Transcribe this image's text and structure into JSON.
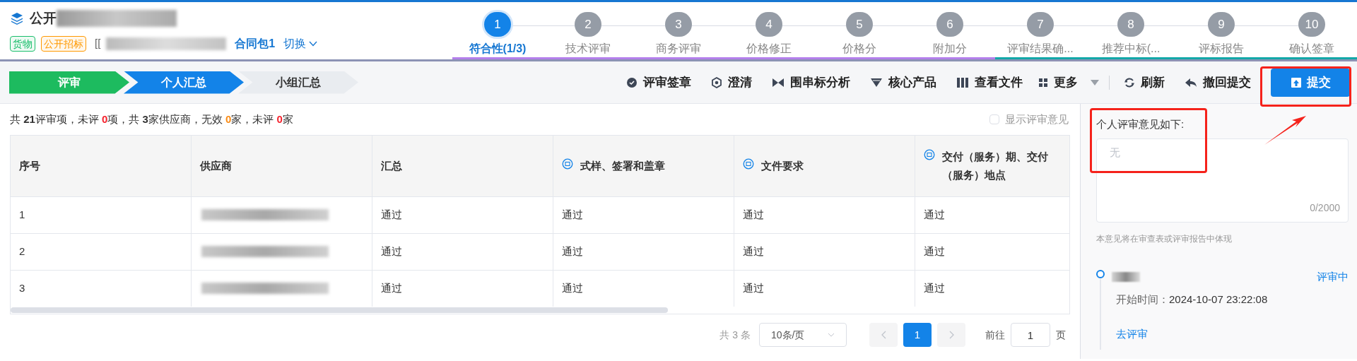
{
  "header": {
    "title": "公开",
    "tags": [
      {
        "label": "货物",
        "color": "#19be6b"
      },
      {
        "label": "公开招标",
        "color": "#ff9900"
      }
    ],
    "project_code": "[[",
    "package": "合同包1",
    "switch": "切换"
  },
  "steps": [
    {
      "number": "1",
      "label": "符合性(1/3)",
      "selected": true,
      "color": "#b37feb"
    },
    {
      "number": "2",
      "label": "技术评审",
      "selected": false,
      "color": "#b37feb"
    },
    {
      "number": "3",
      "label": "商务评审",
      "selected": false,
      "color": "#b37feb"
    },
    {
      "number": "4",
      "label": "价格修正",
      "selected": false,
      "color": "#b37feb"
    },
    {
      "number": "5",
      "label": "价格分",
      "selected": false,
      "color": "#b37feb"
    },
    {
      "number": "6",
      "label": "附加分",
      "selected": false,
      "color": "#b37feb"
    },
    {
      "number": "7",
      "label": "评审结果确...",
      "selected": false,
      "color": "#13a8a8"
    },
    {
      "number": "8",
      "label": "推荐中标(...",
      "selected": false,
      "color": "#13a8a8"
    },
    {
      "number": "9",
      "label": "评标报告",
      "selected": false,
      "color": "#13a8a8"
    },
    {
      "number": "10",
      "label": "确认签章",
      "selected": false,
      "color": "#13a8a8"
    }
  ],
  "breadcrumb": [
    {
      "label": "评审",
      "kind": "done"
    },
    {
      "label": "个人汇总",
      "kind": "current"
    },
    {
      "label": "小组汇总",
      "kind": "pending"
    }
  ],
  "toolbar": [
    {
      "label": "评审签章",
      "kind": "plain"
    },
    {
      "label": "澄清",
      "kind": "plain"
    },
    {
      "label": "围串标分析",
      "kind": "plain"
    },
    {
      "label": "核心产品",
      "kind": "plain"
    },
    {
      "label": "查看文件",
      "kind": "plain"
    },
    {
      "label": "更多",
      "kind": "dropdown"
    },
    {
      "label": "刷新",
      "kind": "plain"
    },
    {
      "label": "撤回提交",
      "kind": "plain"
    },
    {
      "label": "提交",
      "kind": "primary"
    }
  ],
  "summary": [
    {
      "text": "共 ",
      "kind": "plain"
    },
    {
      "text": "21",
      "kind": "bold"
    },
    {
      "text": "评审项，未评 ",
      "kind": "plain"
    },
    {
      "text": "0",
      "kind": "red"
    },
    {
      "text": "项，共 ",
      "kind": "plain"
    },
    {
      "text": "3",
      "kind": "bold"
    },
    {
      "text": "家供应商，无效 ",
      "kind": "plain"
    },
    {
      "text": "0",
      "kind": "orange"
    },
    {
      "text": "家，未评 ",
      "kind": "plain"
    },
    {
      "text": "0",
      "kind": "red"
    },
    {
      "text": "家",
      "kind": "plain"
    }
  ],
  "show_comments": {
    "label": "显示评审意见",
    "checked": false
  },
  "table": {
    "columns": [
      {
        "label": "序号",
        "kind": "plain"
      },
      {
        "label": "供应商",
        "kind": "plain"
      },
      {
        "label": "汇总",
        "kind": "plain"
      },
      {
        "label": "式样、签署和盖章",
        "kind": "criterion"
      },
      {
        "label": "文件要求",
        "kind": "criterion"
      },
      {
        "label": "交付（服务）期、交付（服务）地点",
        "kind": "criterion"
      }
    ],
    "rows": [
      {
        "number": "1",
        "results": [
          "通过",
          "通过",
          "通过",
          "通过"
        ]
      },
      {
        "number": "2",
        "results": [
          "通过",
          "通过",
          "通过",
          "通过"
        ]
      },
      {
        "number": "3",
        "results": [
          "通过",
          "通过",
          "通过",
          "通过"
        ]
      }
    ]
  },
  "pagination": {
    "total": "共 3 条",
    "page_size": "10条/页",
    "pages": [
      {
        "label": "1",
        "selected": true
      }
    ],
    "goto_label": "前往",
    "goto_value": "1",
    "page_suffix": "页"
  },
  "comment": {
    "label": "个人评审意见如下:",
    "placeholder": "无",
    "counter": "0/2000",
    "hint": "本意见将在审查表或评审报告中体现"
  },
  "timeline": [
    {
      "status": "评审中",
      "start_label": "开始时间：",
      "start_time": "2024-10-07 23:22:08",
      "action": "去评审"
    }
  ]
}
